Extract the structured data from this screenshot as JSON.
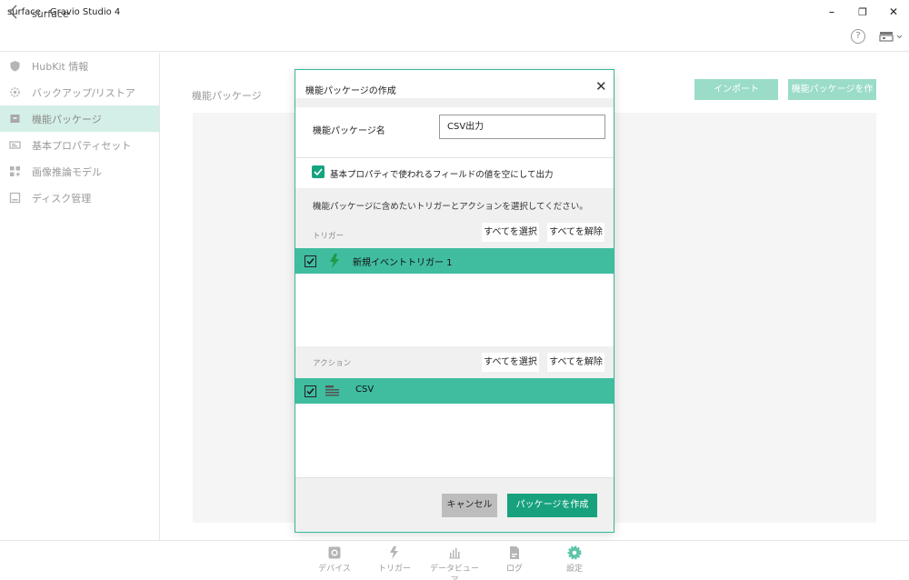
{
  "window": {
    "title": "surface - Gravio Studio 4",
    "minimize": "–",
    "restore": "❐",
    "close": "✕"
  },
  "nav": {
    "back": "‹",
    "title": "surface",
    "help": "?"
  },
  "sidebar": {
    "items": [
      {
        "label": "HubKit 情報",
        "icon": "shield-icon"
      },
      {
        "label": "バックアップ/リストア",
        "icon": "gear-icon"
      },
      {
        "label": "機能パッケージ",
        "icon": "package-icon",
        "active": true
      },
      {
        "label": "基本プロパティセット",
        "icon": "card-icon"
      },
      {
        "label": "画像推論モデル",
        "icon": "grid-icon"
      },
      {
        "label": "ディスク管理",
        "icon": "disk-icon"
      }
    ]
  },
  "main": {
    "section_label": "機能パッケージ",
    "import_button": "インポート",
    "create_button": "機能パッケージを作成"
  },
  "dialog": {
    "title": "機能パッケージの作成",
    "close": "✕",
    "name_label": "機能パッケージ名",
    "name_value": "CSV出力",
    "checkbox_label": "基本プロパティで使われるフィールドの値を空にして出力",
    "instruction": "機能パッケージに含めたいトリガーとアクションを選択してください。",
    "trigger_section": {
      "label": "トリガー",
      "select_all": "すべてを選択",
      "deselect_all": "すべてを解除",
      "items": [
        {
          "label": "新規イベントトリガー 1",
          "icon": "lightning-icon",
          "checked": true
        }
      ]
    },
    "action_section": {
      "label": "アクション",
      "select_all": "すべてを選択",
      "deselect_all": "すべてを解除",
      "items": [
        {
          "label": "CSV",
          "icon": "action-icon",
          "checked": true
        }
      ]
    },
    "cancel_button": "キャンセル",
    "create_button": "パッケージを作成"
  },
  "tabbar": {
    "tabs": [
      {
        "label": "デバイス",
        "icon": "device-icon"
      },
      {
        "label": "トリガー",
        "icon": "trigger-icon"
      },
      {
        "label": "データビューア",
        "icon": "chart-icon"
      },
      {
        "label": "ログ",
        "icon": "log-icon"
      },
      {
        "label": "設定",
        "icon": "settings-icon",
        "active": true
      }
    ]
  },
  "colors": {
    "accent": "#17a27d",
    "row_highlight": "#40bc9f",
    "sidebar_active": "#d4efe7",
    "disabled_button": "#9adcc8"
  }
}
